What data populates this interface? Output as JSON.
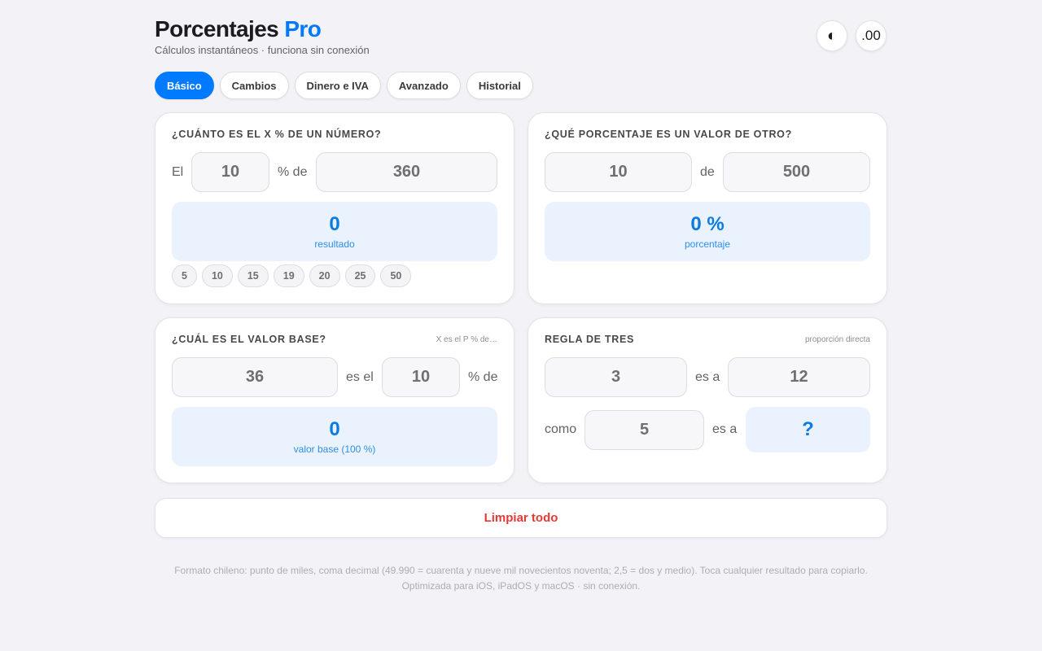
{
  "header": {
    "title_main": "Porcentajes",
    "title_accent": "Pro",
    "subtitle": "Cálculos instantáneos · funciona sin conexión",
    "theme_icon": "◐",
    "decimals_label": ".00"
  },
  "tabs": [
    {
      "label": "Básico",
      "active": true
    },
    {
      "label": "Cambios",
      "active": false
    },
    {
      "label": "Dinero e IVA",
      "active": false
    },
    {
      "label": "Avanzado",
      "active": false
    },
    {
      "label": "Historial",
      "active": false
    }
  ],
  "card_percent_of": {
    "title": "¿CUÁNTO ES EL X % DE UN NÚMERO?",
    "prefix": "El",
    "percent_value": "10",
    "mid_label": "% de",
    "number_value": "360",
    "result_value": "0",
    "result_caption": "resultado",
    "chips": [
      "5",
      "10",
      "15",
      "19",
      "20",
      "25",
      "50"
    ]
  },
  "card_what_percent": {
    "title": "¿QUÉ PORCENTAJE ES UN VALOR DE OTRO?",
    "value": "10",
    "mid_label": "de",
    "total": "500",
    "result_value": "0 %",
    "result_caption": "porcentaje"
  },
  "card_base_value": {
    "title": "¿CUÁL ES EL VALOR BASE?",
    "hint": "X es el P % de…",
    "value": "36",
    "mid_label": "es el",
    "percent": "10",
    "suffix": "% de",
    "result_value": "0",
    "result_caption": "valor base (100 %)"
  },
  "card_rule_of_three": {
    "title": "REGLA DE TRES",
    "hint": "proporción directa",
    "a": "3",
    "label_is_to_1": "es a",
    "b": "12",
    "label_as": "como",
    "c": "5",
    "label_is_to_2": "es a",
    "result": "?"
  },
  "clear_all_label": "Limpiar todo",
  "footer": {
    "line1": "Formato chileno: punto de miles, coma decimal (49.990 = cuarenta y nueve mil novecientos noventa; 2,5 = dos y medio). Toca cualquier resultado para copiarlo.",
    "line2": "Optimizada para iOS, iPadOS y macOS · sin conexión."
  }
}
